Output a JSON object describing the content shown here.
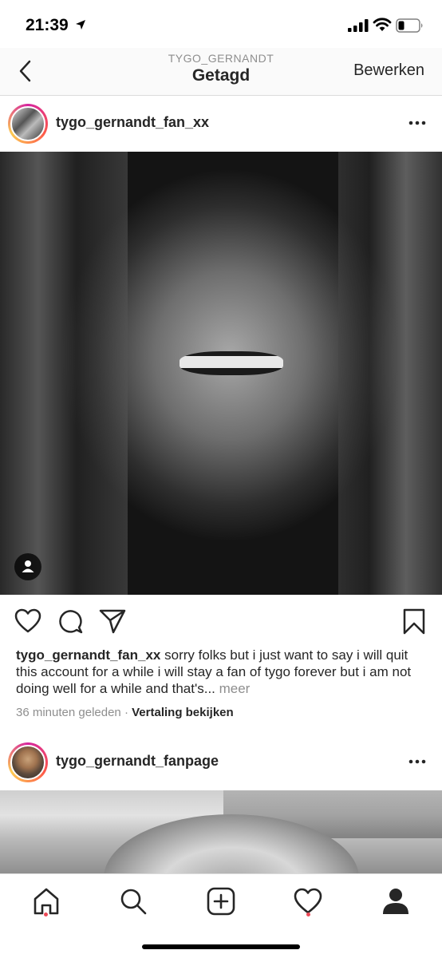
{
  "status_bar": {
    "time": "21:39"
  },
  "header": {
    "subtitle": "TYGO_GERNANDT",
    "title": "Getagd",
    "edit_label": "Bewerken"
  },
  "posts": [
    {
      "username": "tygo_gernandt_fan_xx",
      "caption_user": "tygo_gernandt_fan_xx",
      "caption_text": " sorry folks but i just want to say i will quit this account for a while i will stay a fan of tygo forever but i am not doing well for a while and that's...",
      "more_label": " meer",
      "timestamp": "36 minuten geleden",
      "separator": " · ",
      "translate_label": "Vertaling bekijken"
    },
    {
      "username": "tygo_gernandt_fanpage"
    }
  ],
  "icons": {
    "status": [
      "location-arrow-icon",
      "cellular-signal-icon",
      "wifi-icon",
      "battery-icon"
    ],
    "nav": [
      "back-chevron-icon"
    ],
    "post": [
      "more-options-icon",
      "tagged-user-icon",
      "heart-icon",
      "comment-icon",
      "share-icon",
      "bookmark-icon"
    ],
    "tabs": [
      "home-icon",
      "search-icon",
      "new-post-icon",
      "activity-icon",
      "profile-icon"
    ]
  },
  "colors": {
    "notification_dot": "#ed4956",
    "text_primary": "#262626",
    "text_secondary": "#8e8e8e",
    "divider": "#dbdbdb"
  }
}
